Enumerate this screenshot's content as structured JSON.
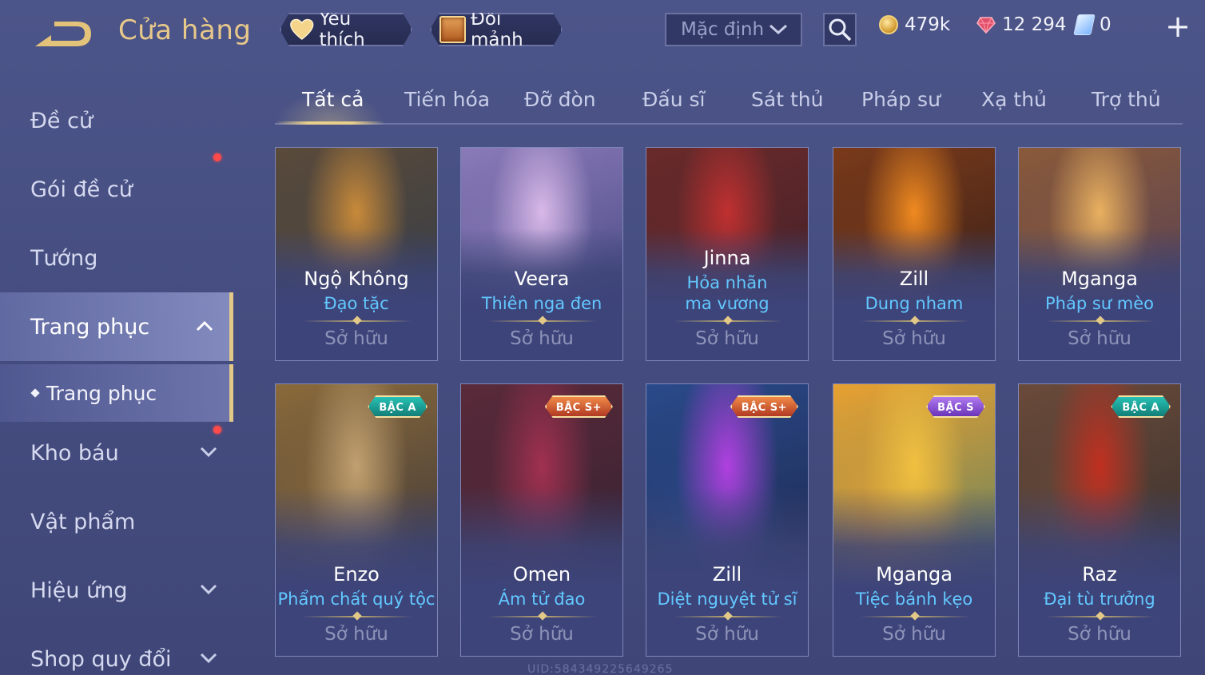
{
  "header": {
    "title": "Cửa hàng",
    "favorites_label": "Yêu thích",
    "fragments_label": "Đổi mảnh",
    "sort_value": "Mặc định",
    "currencies": [
      {
        "icon": "gold-coin-icon",
        "value": "479k"
      },
      {
        "icon": "ruby-gem-icon",
        "value": "12 294"
      },
      {
        "icon": "voucher-icon",
        "value": "0"
      }
    ]
  },
  "sidebar": {
    "items": [
      {
        "label": "Đề cử"
      },
      {
        "label": "Gói đề cử",
        "notify": true
      },
      {
        "label": "Tướng"
      },
      {
        "label": "Trang phục",
        "expanded": true,
        "active": true
      },
      {
        "label": "Kho báu",
        "notify": true
      },
      {
        "label": "Vật phẩm"
      },
      {
        "label": "Hiệu ứng"
      },
      {
        "label": "Shop quy đổi"
      }
    ],
    "sub_item": "Trang phục"
  },
  "tabs": [
    {
      "label": "Tất cả",
      "active": true
    },
    {
      "label": "Tiến hóa"
    },
    {
      "label": "Đỡ đòn"
    },
    {
      "label": "Đấu sĩ"
    },
    {
      "label": "Sát thủ"
    },
    {
      "label": "Pháp sư"
    },
    {
      "label": "Xạ thủ"
    },
    {
      "label": "Trợ thủ"
    }
  ],
  "cards": [
    {
      "hero": "Ngộ Không",
      "skin": "Đạo tặc",
      "status": "Sở hữu",
      "badge": "",
      "colors": [
        "#5a4a3a",
        "#2d3a4a",
        "#c88a3a"
      ]
    },
    {
      "hero": "Veera",
      "skin": "Thiên nga đen",
      "status": "Sở hữu",
      "badge": "",
      "colors": [
        "#8a7ab8",
        "#3a3f78",
        "#d8b8e8"
      ]
    },
    {
      "hero": "Jinna",
      "skin": "Hỏa nhãn ma vương",
      "status": "Sở hữu",
      "badge": "",
      "colors": [
        "#6a2a2a",
        "#3a1f2a",
        "#c03030"
      ]
    },
    {
      "hero": "Zill",
      "skin": "Dung nham",
      "status": "Sở hữu",
      "badge": "",
      "colors": [
        "#7a3a1a",
        "#2a1a18",
        "#f08a20"
      ]
    },
    {
      "hero": "Mganga",
      "skin": "Pháp sư mèo",
      "status": "Sở hữu",
      "badge": "",
      "colors": [
        "#8a5a3a",
        "#4a3a5a",
        "#e8b060"
      ]
    },
    {
      "hero": "Enzo",
      "skin": "Phẩm chất quý tộc",
      "status": "Sở hữu",
      "badge": "BẬC A",
      "badge_type": "a",
      "colors": [
        "#8a6a3a",
        "#2a2a3a",
        "#c0a070"
      ]
    },
    {
      "hero": "Omen",
      "skin": "Ám tử đao",
      "status": "Sở hữu",
      "badge": "BẬC S+",
      "badge_type": "splus",
      "colors": [
        "#5a2a3a",
        "#2a1f2f",
        "#a03050"
      ]
    },
    {
      "hero": "Zill",
      "skin": "Diệt nguyệt tử sĩ",
      "status": "Sở hữu",
      "badge": "BẬC S+",
      "badge_type": "splus",
      "colors": [
        "#2a4a8a",
        "#1a2040",
        "#b040e0"
      ]
    },
    {
      "hero": "Mganga",
      "skin": "Tiệc bánh kẹo",
      "status": "Sở hữu",
      "badge": "BẬC S",
      "badge_type": "s",
      "colors": [
        "#e8a030",
        "#3a7a70",
        "#f0c040"
      ]
    },
    {
      "hero": "Raz",
      "skin": "Đại tù trưởng",
      "status": "Sở hữu",
      "badge": "BẬC A",
      "badge_type": "a",
      "colors": [
        "#6a4a3a",
        "#2a2a2a",
        "#c03020"
      ]
    }
  ],
  "uid": "UID:584349225649265"
}
